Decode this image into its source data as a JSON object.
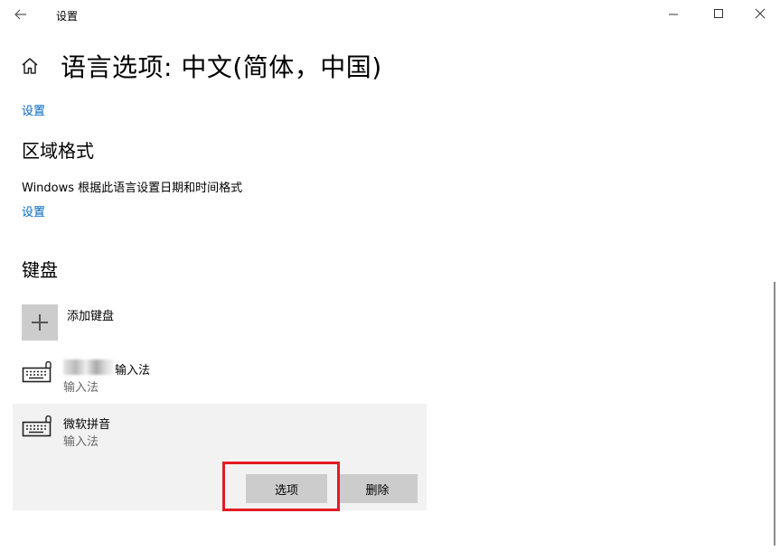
{
  "window": {
    "title": "设置"
  },
  "page": {
    "title": "语言选项: 中文(简体，中国)"
  },
  "top_link": "设置",
  "region_format": {
    "heading": "区域格式",
    "description": "Windows 根据此语言设置日期和时间格式",
    "link": "设置"
  },
  "keyboards": {
    "heading": "键盘",
    "add_label": "添加键盘",
    "items": [
      {
        "name_suffix": "输入法",
        "subtitle": "输入法",
        "icon": "keyboard-icon"
      },
      {
        "name": "微软拼音",
        "subtitle": "输入法",
        "icon": "keyboard-icon"
      }
    ],
    "options_button": "选项",
    "remove_button": "删除"
  },
  "colors": {
    "link": "#0067c0",
    "highlight": "#e31b23",
    "selected_bg": "#f2f2f2",
    "button_bg": "#cccccc"
  }
}
